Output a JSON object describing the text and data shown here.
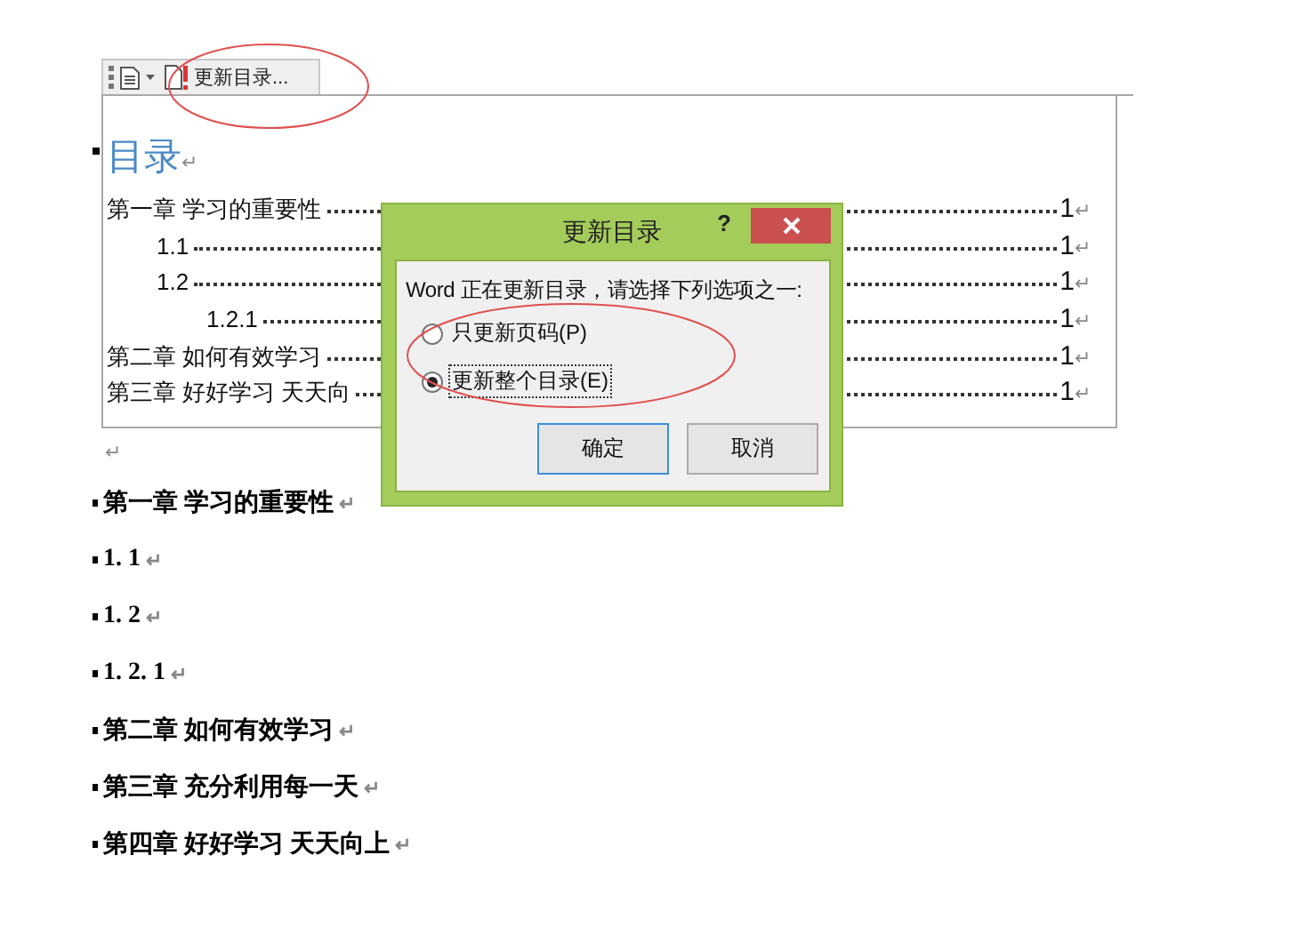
{
  "toolbar": {
    "update_button": {
      "label": "更新目录..."
    }
  },
  "toc": {
    "title": "目录",
    "end_mark": "↵",
    "entries": [
      {
        "title": "第一章 学习的重要性",
        "page": "1",
        "end_mark": "↵",
        "children": [
          {
            "title": "1.1",
            "page": "1",
            "end_mark": "↵"
          },
          {
            "title": "1.2",
            "page": "1",
            "end_mark": "↵",
            "children": [
              {
                "title": "1.2.1",
                "page": "1",
                "end_mark": "↵"
              }
            ]
          }
        ]
      },
      {
        "title": "第二章 如何有效学习",
        "page": "1",
        "end_mark": "↵"
      },
      {
        "title": "第三章 好好学习 天天向",
        "page": "1",
        "end_mark": "↵"
      }
    ],
    "after_mark": "↵"
  },
  "headings": [
    {
      "text": "第一章 学习的重要性",
      "end_mark": "↵"
    },
    {
      "text": "1. 1",
      "end_mark": "↵"
    },
    {
      "text": "1. 2",
      "end_mark": "↵"
    },
    {
      "text": "1. 2. 1",
      "end_mark": "↵"
    },
    {
      "text": "第二章 如何有效学习",
      "end_mark": "↵"
    },
    {
      "text": "第三章 充分利用每一天",
      "end_mark": "↵"
    },
    {
      "text": "第四章 好好学习 天天向上",
      "end_mark": "↵"
    }
  ],
  "dialog": {
    "title": "更新目录",
    "help": "?",
    "message": "Word 正在更新目录，请选择下列选项之一:",
    "options": [
      {
        "label": "只更新页码(P)",
        "selected": false,
        "focused": false
      },
      {
        "label": "更新整个目录(E)",
        "selected": true,
        "focused": true
      }
    ],
    "buttons": [
      {
        "label": "确定",
        "default": true
      },
      {
        "label": "取消",
        "default": false
      }
    ]
  }
}
